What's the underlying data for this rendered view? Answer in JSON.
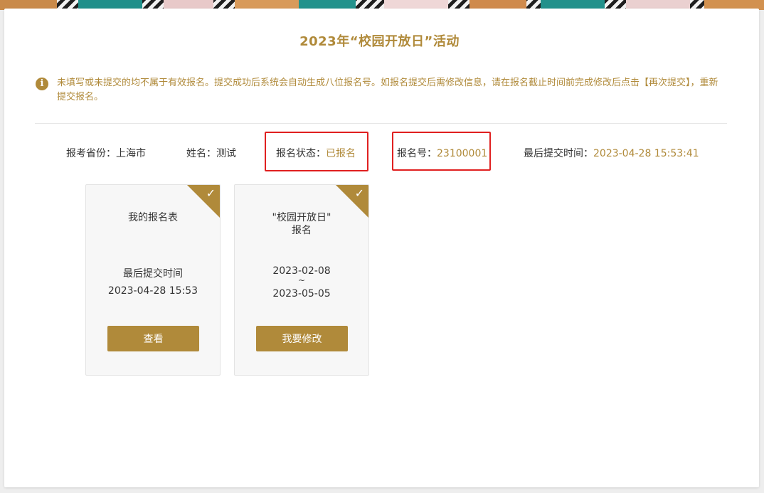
{
  "header": {
    "title": "2023年“校园开放日”活动"
  },
  "notice": {
    "text": "未填写或未提交的均不属于有效报名。提交成功后系统会自动生成八位报名号。如报名提交后需修改信息，请在报名截止时间前完成修改后点击【再次提交】，重新提交报名。",
    "icon": "info-icon"
  },
  "info": {
    "province_label": "报考省份：",
    "province_value": "上海市",
    "name_label": "姓名：",
    "name_value": "测试",
    "status_label": "报名状态：",
    "status_value": "已报名",
    "number_label": "报名号：",
    "number_value": "23100001",
    "last_submit_label": "最后提交时间：",
    "last_submit_value": "2023-04-28 15:53:41"
  },
  "tiles": [
    {
      "title": "我的报名表",
      "sub_label": "最后提交时间",
      "sub_value": "2023-04-28 15:53",
      "button": "查看",
      "check_icon": "checkmark-icon"
    },
    {
      "title_line1": "\"校园开放日\"",
      "title_line2": "报名",
      "date_start": "2023-02-08",
      "date_sep": "~",
      "date_end": "2023-05-05",
      "button": "我要修改",
      "check_icon": "checkmark-icon"
    }
  ],
  "colors": {
    "accent": "#b08a3a",
    "highlight": "#e02020"
  }
}
